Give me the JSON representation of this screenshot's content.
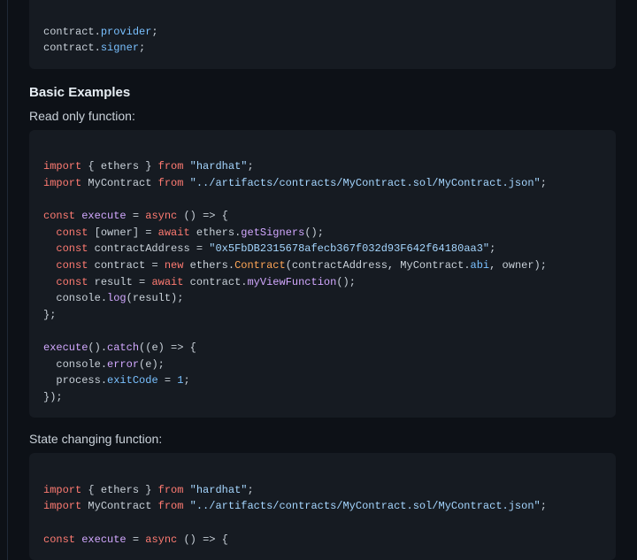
{
  "intro_block": {
    "line1": {
      "obj": "contract",
      "prop": "provider"
    },
    "line2": {
      "obj": "contract",
      "prop": "signer"
    }
  },
  "section": {
    "heading": "Basic Examples",
    "readonly_label": "Read only function:",
    "state_label": "State changing function:"
  },
  "code1": {
    "import1_kw": "import",
    "import1_names": "{ ethers }",
    "import1_from": "from",
    "import1_path": "\"hardhat\"",
    "import2_kw": "import",
    "import2_names": "MyContract",
    "import2_from": "from",
    "import2_path": "\"../artifacts/contracts/MyContract.sol/MyContract.json\"",
    "const_kw": "const",
    "execute_name": "execute",
    "async_kw": "async",
    "arrow_body_open": "() => {",
    "owner_line_kw": "const",
    "owner_destr": "[owner]",
    "await_kw": "await",
    "ethers_obj": "ethers",
    "getSigners_fn": "getSigners",
    "addr_kw": "const",
    "addr_name": "contractAddress",
    "addr_value": "\"0x5FbDB2315678afecb367f032d93F642f64180aa3\"",
    "contract_kw": "const",
    "contract_name": "contract",
    "new_kw": "new",
    "ethers2": "ethers",
    "Contract_cls": "Contract",
    "ctor_args_a": "(contractAddress, MyContract.",
    "abi_prop": "abi",
    "ctor_args_b": ", owner);",
    "result_kw": "const",
    "result_name": "result",
    "await2": "await",
    "contract_obj": "contract",
    "viewfn": "myViewFunction",
    "console_obj": "console",
    "log_fn": "log",
    "log_arg": "(result);",
    "close_brace": "};",
    "exec_call": "execute",
    "catch_fn": "catch",
    "catch_args": "((e) => {",
    "console2": "console",
    "error_fn": "error",
    "error_arg": "(e);",
    "process_obj": "process",
    "exitCode_prop": "exitCode",
    "one": "1",
    "close2": "});"
  },
  "code2": {
    "import1_kw": "import",
    "import1_names": "{ ethers }",
    "import1_from": "from",
    "import1_path": "\"hardhat\"",
    "import2_kw": "import",
    "import2_names": "MyContract",
    "import2_from": "from",
    "import2_path": "\"../artifacts/contracts/MyContract.sol/MyContract.json\"",
    "const_kw": "const",
    "execute_name": "execute",
    "async_kw": "async",
    "arrow_body_open": "() => {"
  }
}
